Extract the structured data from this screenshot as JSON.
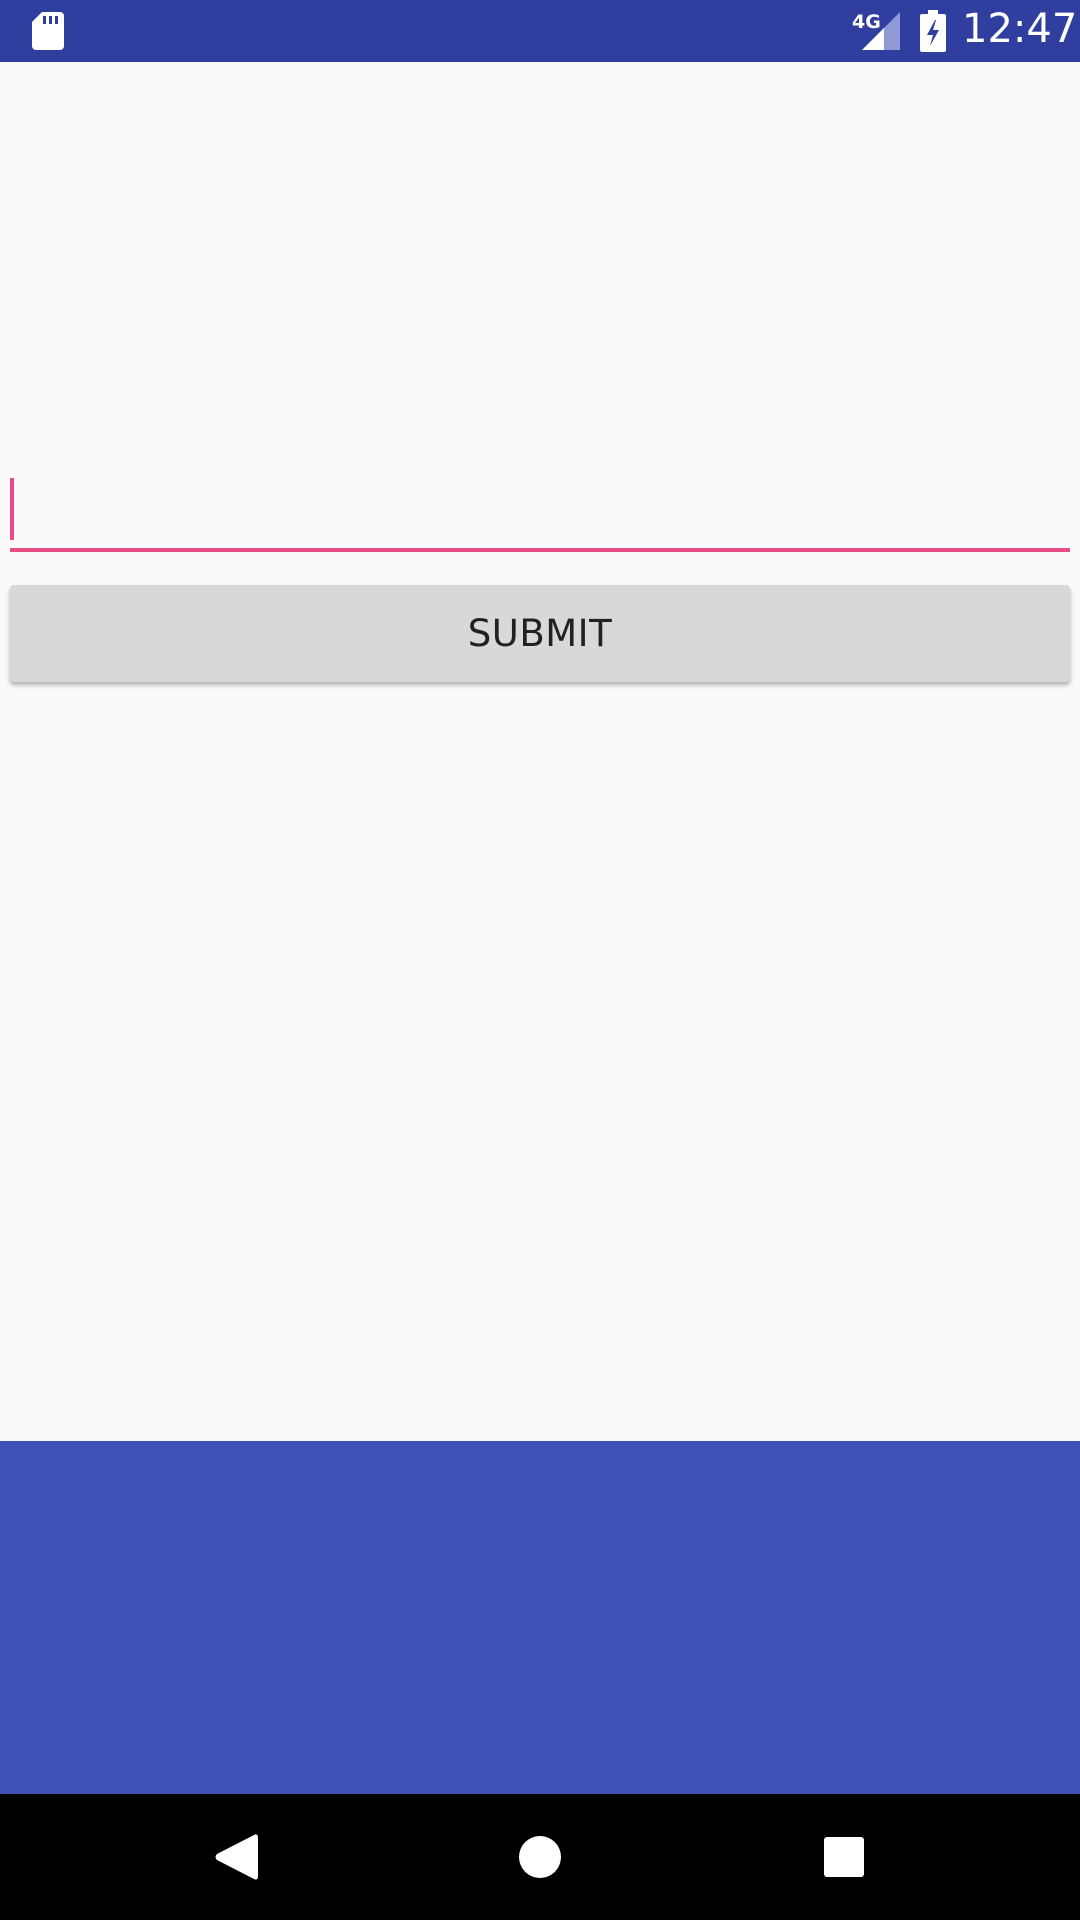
{
  "status_bar": {
    "network_type": "4G",
    "time": "12:47",
    "icons": [
      "sd-card-icon",
      "signal-icon",
      "battery-charging-icon"
    ],
    "background_color": "#303f9f"
  },
  "form": {
    "input_value": "",
    "input_accent_color": "#e94b84",
    "submit_label": "SUBMIT"
  },
  "bottom_panel": {
    "background_color": "#3f51b5"
  },
  "nav_bar": {
    "buttons": [
      "back-icon",
      "home-icon",
      "recents-icon"
    ]
  }
}
